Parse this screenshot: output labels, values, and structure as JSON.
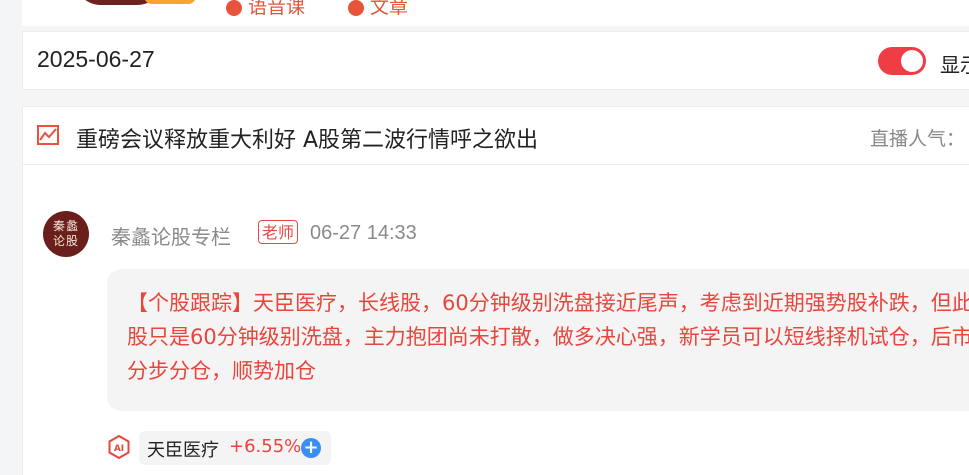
{
  "date": "2025-06-27",
  "toggle": {
    "on": true,
    "label": "显示"
  },
  "live": {
    "title": "重磅会议释放重大利好 A股第二波行情呼之欲出",
    "popularity_label": "直播人气："
  },
  "post": {
    "avatar_text": "秦蠡论股",
    "author": "秦蠡论股专栏",
    "role_badge": "老师",
    "time": "06-27 14:33",
    "message": "【个股跟踪】天臣医疗，长线股，60分钟级别洗盘接近尾声，考虑到近期强势股补跌，但此股只是60分钟级别洗盘，主力抱团尚未打散，做多决心强，新学员可以短线择机试仓，后市分步分仓，顺势加仓"
  },
  "stock": {
    "name": "天臣医疗",
    "change": "+6.55%"
  },
  "top_tags": [
    "语音课",
    "文章"
  ],
  "icons": {
    "chart": "chart-line-icon",
    "ai": "ai-icon",
    "add": "plus-circle-icon"
  },
  "colors": {
    "accent_red": "#e8453c",
    "toggle_on": "#f03d45",
    "add_blue": "#3b8ff2"
  }
}
